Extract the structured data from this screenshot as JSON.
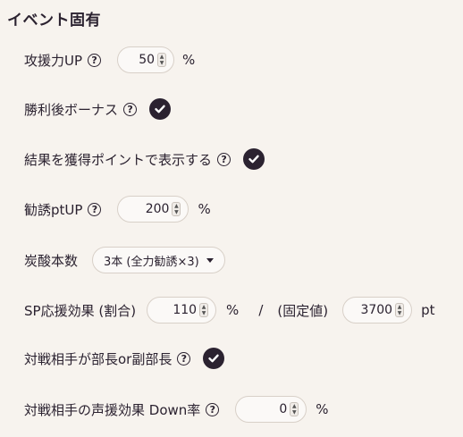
{
  "section_title": "イベント固有",
  "attack_up": {
    "label": "攻援力UP",
    "value": "50",
    "unit": "%"
  },
  "win_bonus": {
    "label": "勝利後ボーナス",
    "checked": true
  },
  "show_points": {
    "label": "結果を獲得ポイントで表示する",
    "checked": true
  },
  "recruit_up": {
    "label": "勧誘ptUP",
    "value": "200",
    "unit": "%"
  },
  "soda": {
    "label": "炭酸本数",
    "selected": "3本 (全力勧誘×3)"
  },
  "sp_effect": {
    "label": "SP応援効果 (割合)",
    "ratio_value": "110",
    "ratio_unit": "%",
    "separator": "/",
    "fixed_label": "(固定値)",
    "fixed_value": "3700",
    "fixed_unit": "pt"
  },
  "opponent_leader": {
    "label": "対戦相手が部長or副部長",
    "checked": true
  },
  "opponent_down": {
    "label": "対戦相手の声援効果 Down率",
    "value": "0",
    "unit": "%"
  },
  "icons": {
    "help": "question-circle-icon",
    "check": "check-circle-icon",
    "dropdown": "caret-down-icon"
  },
  "colors": {
    "background": "#f7f3ee",
    "dark": "#2b2230",
    "field_border": "#d8d0c8"
  }
}
